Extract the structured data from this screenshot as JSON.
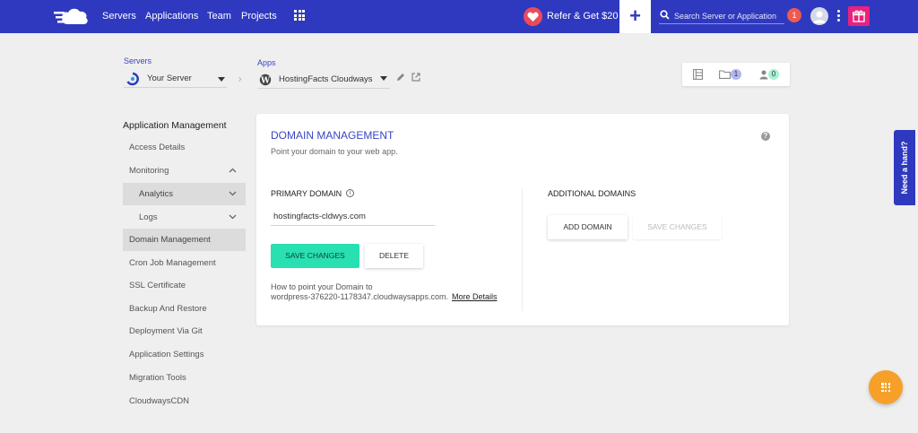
{
  "topbar": {
    "nav": [
      "Servers",
      "Applications",
      "Team",
      "Projects"
    ],
    "refer_label": "Refer & Get $20",
    "plus_label": "+",
    "search_placeholder": "Search Server or Application",
    "notification_count": "1",
    "icons": {
      "logo": "cloudways-logo-icon",
      "apps_grid": "grid-icon",
      "refer": "heart-icon",
      "search": "search-icon",
      "user": "user-avatar-icon",
      "menu": "kebab-menu-icon",
      "gift": "gift-icon"
    }
  },
  "breadcrumb": {
    "server_label": "Servers",
    "server_value": "Your Server",
    "app_label": "Apps",
    "app_value": "HostingFacts Cloudways"
  },
  "widget": {
    "files_count": "1",
    "users_count": "0",
    "colors": {
      "files_badge": "#b3b6ef",
      "users_badge": "#a8f0d4"
    }
  },
  "sidebar": {
    "title": "Application Management",
    "items": [
      {
        "label": "Access Details"
      },
      {
        "label": "Monitoring"
      },
      {
        "label": "Analytics"
      },
      {
        "label": "Logs"
      },
      {
        "label": "Domain Management"
      },
      {
        "label": "Cron Job Management"
      },
      {
        "label": "SSL Certificate"
      },
      {
        "label": "Backup And Restore"
      },
      {
        "label": "Deployment Via Git"
      },
      {
        "label": "Application Settings"
      },
      {
        "label": "Migration Tools"
      },
      {
        "label": "CloudwaysCDN"
      }
    ]
  },
  "card": {
    "title": "DOMAIN MANAGEMENT",
    "subtitle": "Point your domain to your web app.",
    "primary_label": "PRIMARY DOMAIN",
    "primary_value": "hostingfacts-cldwys.com",
    "save_label": "SAVE CHANGES",
    "delete_label": "DELETE",
    "hint_line1": "How to point your Domain to",
    "hint_line2": "wordpress-376220-1178347.cloudwaysapps.com.",
    "more_details": "More Details",
    "additional_label": "ADDITIONAL DOMAINS",
    "add_domain_label": "ADD DOMAIN",
    "save_label_2": "SAVE CHANGES"
  },
  "help": {
    "need_hand": "Need a hand?"
  },
  "colors": {
    "brand": "#2f39bf",
    "accent": "#28e0b1",
    "fab": "#f6a02a",
    "gift": "#e8227d"
  }
}
